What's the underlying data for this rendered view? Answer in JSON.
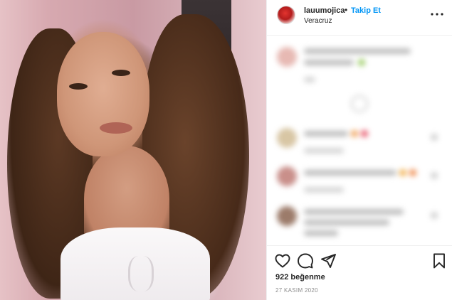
{
  "post": {
    "username": "lauumojica",
    "separator": "•",
    "follow_label": "Takip Et",
    "location": "Veracruz",
    "likes_text": "922 beğenme",
    "date_text": "27 KASIM 2020"
  },
  "icons": {
    "more": "more-options-icon",
    "like": "heart-icon",
    "comment": "comment-icon",
    "share": "paper-plane-icon",
    "save": "bookmark-icon"
  },
  "colors": {
    "follow": "#0095f6",
    "text": "#262626",
    "muted": "#8e8e8e",
    "divider": "#efefef"
  }
}
